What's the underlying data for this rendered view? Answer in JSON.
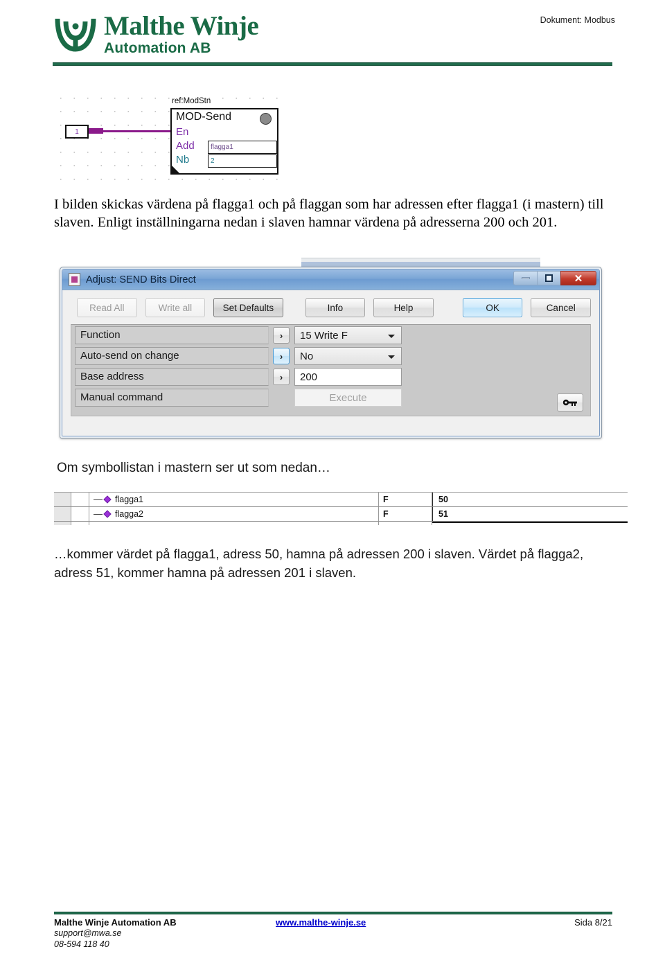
{
  "header": {
    "logo_title": "Malthe Winje",
    "logo_subtitle": "Automation AB",
    "doc_label": "Dokument: Modbus"
  },
  "fbd": {
    "ref_label": "ref:ModStn",
    "block_name": "MOD-Send",
    "input_box_value": "1",
    "pins": [
      {
        "name": "En",
        "value": ""
      },
      {
        "name": "Add",
        "value": "flagga1"
      },
      {
        "name": "Nb",
        "value": "2"
      }
    ]
  },
  "paragraphs": {
    "p1": "I bilden skickas värdena på flagga1 och på flaggan som har adressen efter flagga1 (i mastern) till slaven. Enligt inställningarna nedan i slaven hamnar värdena på adresserna 200 och 201.",
    "p2": "Om symbollistan i mastern ser ut som nedan…",
    "p3": "…kommer värdet på flagga1, adress 50, hamna på adressen 200 i slaven. Värdet på flagga2, adress 51, kommer hamna på adressen 201 i slaven."
  },
  "dialog": {
    "title": "Adjust: SEND Bits Direct",
    "title_icon": "document-properties-icon",
    "window_buttons": {
      "minimize": "minimize-icon",
      "maximize": "maximize-icon",
      "close": "✕"
    },
    "toolbar": {
      "read_all": "Read All",
      "write_all": "Write all",
      "set_defaults": "Set Defaults",
      "info": "Info",
      "help": "Help",
      "ok": "OK",
      "cancel": "Cancel"
    },
    "rows": [
      {
        "label": "Function",
        "arrow": "›",
        "control": "combo",
        "value": "15 Write F"
      },
      {
        "label": "Auto-send on change",
        "arrow": "›",
        "control": "combo",
        "value": "No"
      },
      {
        "label": "Base address",
        "arrow": "›",
        "control": "text",
        "value": "200"
      },
      {
        "label": "Manual command",
        "arrow": "",
        "control": "button",
        "value": "Execute"
      }
    ],
    "key_button": "key-icon"
  },
  "symbol_table": {
    "rows": [
      {
        "name": "flagga1",
        "type": "F",
        "value": "50"
      },
      {
        "name": "flagga2",
        "type": "F",
        "value": "51"
      }
    ]
  },
  "footer": {
    "company": "Malthe Winje Automation AB",
    "email": "support@mwa.se",
    "phone": "08-594 118 40",
    "website": "www.malthe-winje.se",
    "page": "Sida 8/21"
  },
  "colors": {
    "brand_green": "#1f6b4c",
    "link_blue": "#0000cc",
    "pin_purple": "#7d2fa8",
    "wire_magenta": "#8b1a8b",
    "diamond_purple": "#9b30d9"
  }
}
